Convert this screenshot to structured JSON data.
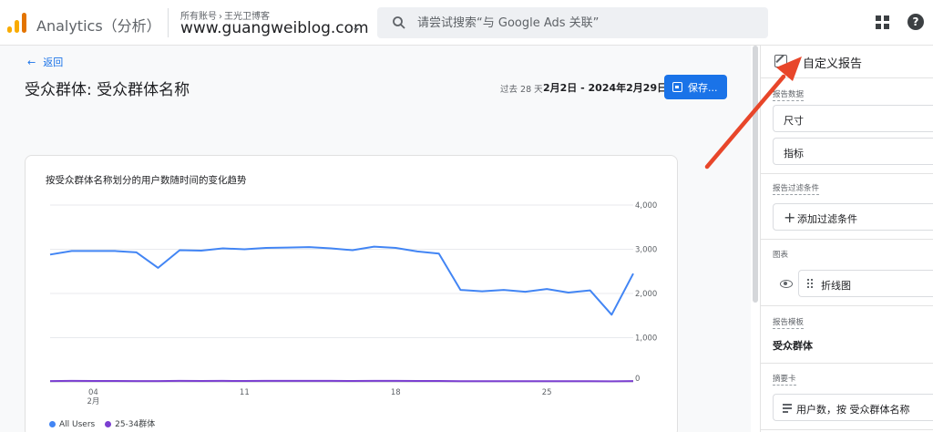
{
  "header": {
    "app_title": "Analytics（分析）",
    "account_breadcrumb": [
      "所有账号",
      "王光卫博客"
    ],
    "account_separator": "›",
    "property_name": "www.guangweiblog.com",
    "search_placeholder": "请尝试搜索“与 Google Ads 关联”",
    "icons": [
      "analytics-logo-icon",
      "chevron-down-icon",
      "search-icon",
      "apps-grid-icon",
      "help-icon"
    ]
  },
  "main": {
    "back_label": "返回",
    "page_title": "受众群体: 受众群体名称",
    "date_range_label": "过去 28 天",
    "date_range_value": "2月2日 - 2024年2月29日",
    "save_label": "保存..."
  },
  "chart_card": {
    "title": "按受众群体名称划分的用户数随时间的变化趋势"
  },
  "chart_data": {
    "type": "line",
    "title": "按受众群体名称划分的用户数随时间的变化趋势",
    "x": [
      "2月2日",
      "2月3日",
      "2月4日",
      "2月5日",
      "2月6日",
      "2月7日",
      "2月8日",
      "2月9日",
      "2月10日",
      "2月11日",
      "2月12日",
      "2月13日",
      "2月14日",
      "2月15日",
      "2月16日",
      "2月17日",
      "2月18日",
      "2月19日",
      "2月20日",
      "2月21日",
      "2月22日",
      "2月23日",
      "2月24日",
      "2月25日",
      "2月26日",
      "2月27日",
      "2月28日",
      "2月29日"
    ],
    "x_tick_labels": [
      {
        "index": 2,
        "label": "04",
        "sublabel": "2月"
      },
      {
        "index": 9,
        "label": "11",
        "sublabel": ""
      },
      {
        "index": 16,
        "label": "18",
        "sublabel": ""
      },
      {
        "index": 23,
        "label": "25",
        "sublabel": ""
      }
    ],
    "series": [
      {
        "name": "All Users",
        "color": "#4285f4",
        "values": [
          2880,
          2960,
          2960,
          2960,
          2930,
          2580,
          2980,
          2970,
          3020,
          3000,
          3030,
          3040,
          3050,
          3020,
          2980,
          3060,
          3030,
          2950,
          2900,
          2080,
          2050,
          2080,
          2040,
          2100,
          2020,
          2070,
          1520,
          2450
        ]
      },
      {
        "name": "25-34群体",
        "color": "#7b3fd1",
        "values": [
          18,
          22,
          20,
          20,
          19,
          18,
          22,
          21,
          22,
          21,
          22,
          22,
          23,
          22,
          21,
          23,
          22,
          21,
          20,
          16,
          15,
          16,
          15,
          16,
          15,
          16,
          12,
          18
        ]
      }
    ],
    "y_ticks": [
      "4,000",
      "3,000",
      "2,000",
      "1,000",
      "0"
    ],
    "ylim": [
      0,
      4000
    ],
    "grid": true,
    "legend_position": "bottom-left"
  },
  "panel": {
    "title": "自定义报告",
    "sections": {
      "report_data_label": "报告数据",
      "dimensions_label": "尺寸",
      "metrics_label": "指标",
      "filter_label": "报告过滤条件",
      "add_filter_label": "添加过滤条件",
      "chart_label": "图表",
      "chart_type_label": "折线图",
      "template_label": "报告模板",
      "template_name": "受众群体",
      "summary_label": "摘要卡",
      "summary_value": "用户数，按 受众群体名称"
    }
  },
  "annotation": {
    "arrow_color": "#e8462a"
  }
}
